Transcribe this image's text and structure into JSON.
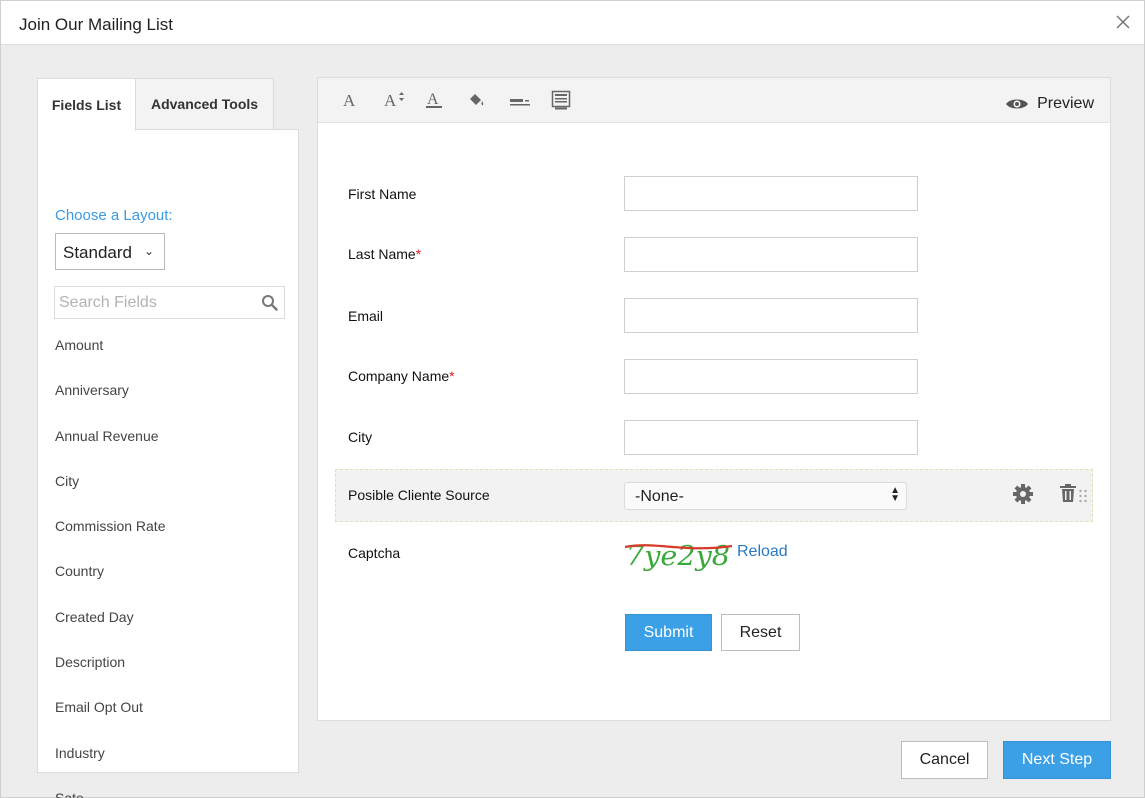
{
  "dialog": {
    "title": "Join Our Mailing List",
    "close_icon": "close-icon"
  },
  "left": {
    "tabs": [
      {
        "label": "Fields List",
        "active": true
      },
      {
        "label": "Advanced Tools",
        "active": false
      }
    ],
    "layout_label": "Choose a Layout:",
    "layout_value": "Standard",
    "search_placeholder": "Search Fields",
    "fields": [
      "Amount",
      "Anniversary",
      "Annual Revenue",
      "City",
      "Commission Rate",
      "Country",
      "Created Day",
      "Description",
      "Email Opt Out",
      "Industry",
      "Sate"
    ]
  },
  "toolbar": {
    "tools": [
      "font-icon",
      "font-size-icon",
      "font-color-icon",
      "fill-color-icon",
      "border-style-icon",
      "layout-icon"
    ],
    "preview_label": "Preview"
  },
  "form": {
    "fields": [
      {
        "label": "First Name",
        "required": false
      },
      {
        "label": "Last Name",
        "required": true
      },
      {
        "label": "Email",
        "required": false
      },
      {
        "label": "Company Name",
        "required": true
      },
      {
        "label": "City",
        "required": false
      }
    ],
    "required_mark": "*",
    "source_label": "Posible Cliente Source",
    "source_value": "-None-",
    "captcha_label": "Captcha",
    "captcha_text": "7ye2y8",
    "reload_label": "Reload",
    "submit_label": "Submit",
    "reset_label": "Reset"
  },
  "footer": {
    "cancel_label": "Cancel",
    "next_label": "Next Step"
  },
  "colors": {
    "accent": "#3ba0e6",
    "link": "#2a7ac0",
    "required": "#e02020",
    "captcha_green": "#3aa83a",
    "captcha_strike": "#d83a2a"
  }
}
